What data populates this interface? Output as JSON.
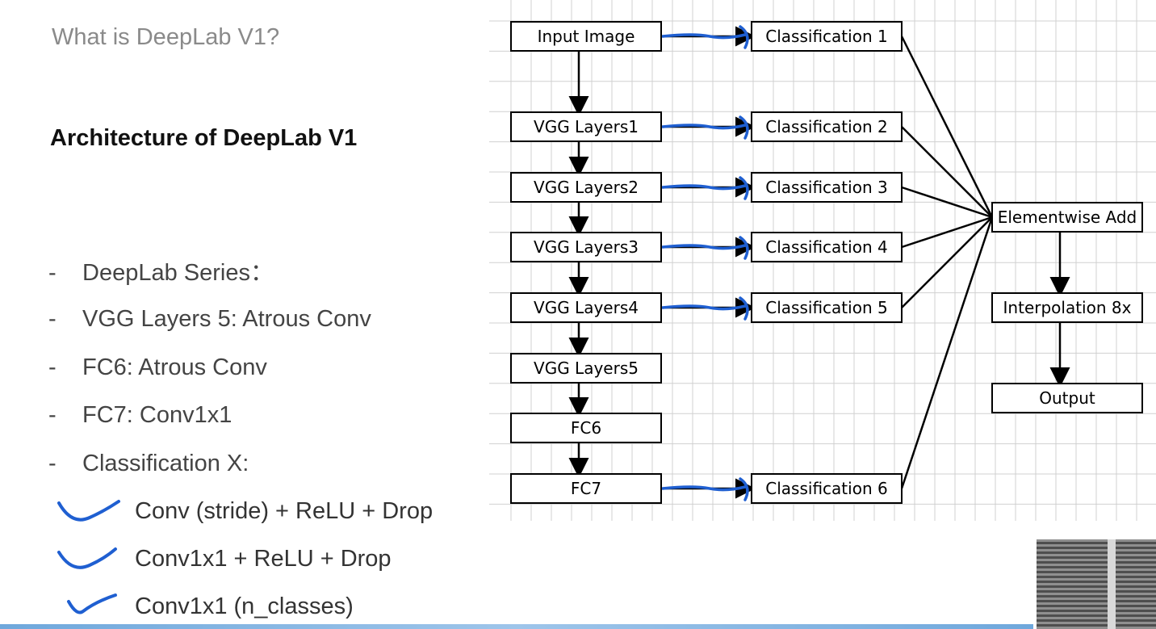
{
  "slide": {
    "subtitle": "What is DeepLab V1?",
    "heading": "Architecture of DeepLab V1",
    "bullets": [
      "DeepLab Series：",
      "VGG Layers 5: Atrous Conv",
      "FC6: Atrous Conv",
      "FC7: Conv1x1",
      "Classification X:"
    ],
    "checklist": [
      "Conv (stride) + ReLU + Drop",
      "Conv1x1 + ReLU + Drop",
      "Conv1x1 (n_classes)"
    ],
    "bullet_marker": "-"
  },
  "diagram": {
    "backbone": [
      "Input Image",
      "VGG Layers1",
      "VGG Layers2",
      "VGG Layers3",
      "VGG Layers4",
      "VGG Layers5",
      "FC6",
      "FC7"
    ],
    "classifiers": [
      "Classification 1",
      "Classification 2",
      "Classification 3",
      "Classification 4",
      "Classification 5",
      "Classification 6"
    ],
    "merge": "Elementwise Add",
    "upsample": "Interpolation 8x",
    "output": "Output",
    "annotation_color": "#1f5fd1",
    "grid_color": "#d0d0d0",
    "edges": [
      [
        "Input Image",
        "VGG Layers1"
      ],
      [
        "VGG Layers1",
        "VGG Layers2"
      ],
      [
        "VGG Layers2",
        "VGG Layers3"
      ],
      [
        "VGG Layers3",
        "VGG Layers4"
      ],
      [
        "VGG Layers4",
        "VGG Layers5"
      ],
      [
        "VGG Layers5",
        "FC6"
      ],
      [
        "FC6",
        "FC7"
      ],
      [
        "Input Image",
        "Classification 1"
      ],
      [
        "VGG Layers1",
        "Classification 2"
      ],
      [
        "VGG Layers2",
        "Classification 3"
      ],
      [
        "VGG Layers3",
        "Classification 4"
      ],
      [
        "VGG Layers4",
        "Classification 5"
      ],
      [
        "FC7",
        "Classification 6"
      ],
      [
        "Classification 1",
        "Elementwise Add"
      ],
      [
        "Classification 2",
        "Elementwise Add"
      ],
      [
        "Classification 3",
        "Elementwise Add"
      ],
      [
        "Classification 4",
        "Elementwise Add"
      ],
      [
        "Classification 5",
        "Elementwise Add"
      ],
      [
        "Classification 6",
        "Elementwise Add"
      ],
      [
        "Elementwise Add",
        "Interpolation 8x"
      ],
      [
        "Interpolation 8x",
        "Output"
      ]
    ]
  }
}
